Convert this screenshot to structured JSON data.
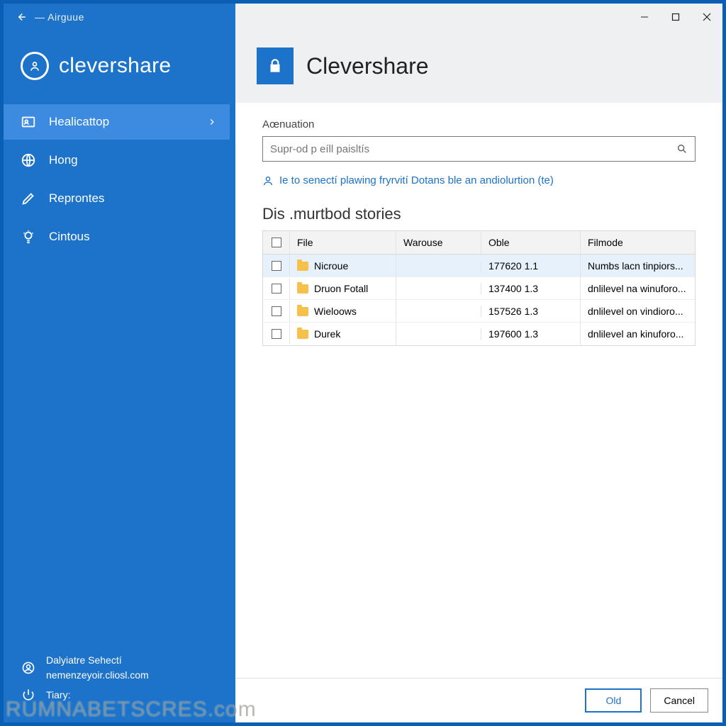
{
  "topbar": {
    "title": "— Airguue"
  },
  "brand": "clevershare",
  "sidebar": {
    "items": [
      {
        "label": "Healicattop"
      },
      {
        "label": "Hong"
      },
      {
        "label": "Reprontes"
      },
      {
        "label": "Cintous"
      }
    ],
    "footer": {
      "line1": "Dalyiatre Sehectí",
      "line2": "nemenzeyoir.cliosl.com",
      "line3": "Tiary:"
    }
  },
  "main": {
    "title": "Clevershare",
    "field_label": "Aœnuation",
    "search_placeholder": "Supr-od p eíll paisltís",
    "hint": "Ie to senectí plawing fryrvití Dotans ble an andiolurtion (te)",
    "section_title": "Dis .murtbod stories",
    "columns": {
      "file": "File",
      "warouse": "Warouse",
      "oble": "Oble",
      "filmode": "Filmode"
    },
    "rows": [
      {
        "file": "Nicroue",
        "warouse": "",
        "oble": "177620 1.1",
        "filmode": "Numbs lacn tinpiors..."
      },
      {
        "file": "Druon Fotall",
        "warouse": "",
        "oble": "137400 1.3",
        "filmode": "dnlilevel na winuforo..."
      },
      {
        "file": "Wieloows",
        "warouse": "",
        "oble": "157526 1.3",
        "filmode": "dnlilevel on vindioro..."
      },
      {
        "file": "Durek",
        "warouse": "",
        "oble": "197600 1.3",
        "filmode": "dnlilevel an kinuforo..."
      }
    ],
    "buttons": {
      "ok": "Old",
      "cancel": "Cancel"
    }
  },
  "watermark": "RUMNABETSCRES.com"
}
